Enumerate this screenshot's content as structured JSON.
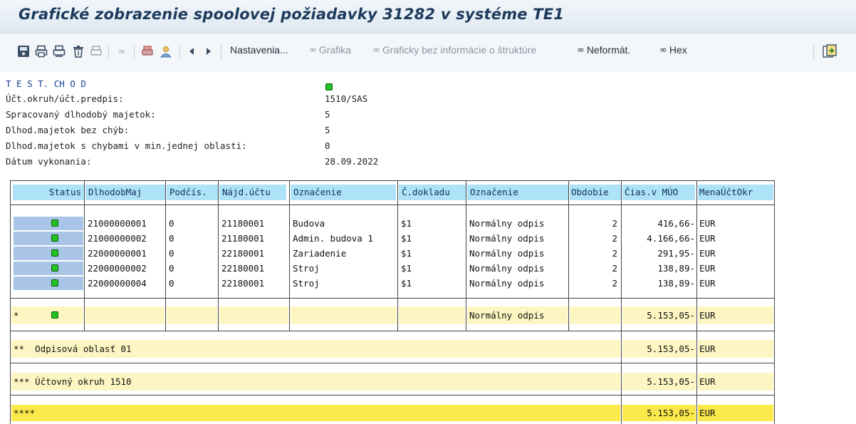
{
  "window": {
    "title": "Grafické zobrazenie spoolovej požiadavky 31282 v systéme TE1"
  },
  "toolbar": {
    "icons": [
      "save-local-icon",
      "print-icon",
      "print-immediately-icon",
      "delete-icon",
      "printer-settings-icon",
      "glasses-icon",
      "print-preview-icon",
      "user-icon",
      "previous-icon",
      "next-icon"
    ],
    "settings_label": "Nastavenia...",
    "graphic_label": "Grafika",
    "graphic_nostruct_label": "Graficky bez informácie o štruktúre",
    "unformatted_label": "Neformát.",
    "hex_label": "Hex"
  },
  "header": {
    "run_label": "T E S T. CH O D",
    "fields": [
      {
        "label": "Účt.okruh/účt.predpis:",
        "value": "1510/SAS"
      },
      {
        "label": "Spracovaný dlhodobý majetok:",
        "value": "5"
      },
      {
        "label": "Dlhod.majetok bez chýb:",
        "value": "5"
      },
      {
        "label": "Dlhod.majetok s chybami v min.jednej oblasti:",
        "value": "0"
      },
      {
        "label": "Dátum vykonania:",
        "value": "28.09.2022"
      }
    ]
  },
  "grid": {
    "columns": [
      "Status",
      "DlhodobMaj",
      "Podčís.",
      "Nájd.účtu",
      "Označenie",
      "Č.dokladu",
      "Označenie",
      "Obdobie",
      "Čias.v MÚO",
      "MenaÚčtOkr"
    ],
    "rows": [
      {
        "asset": "21000000001",
        "sub": "0",
        "account": "21180001",
        "desc": "Budova",
        "doc": "$1",
        "desc2": "Normálny odpis",
        "period": "2",
        "amount": "416,66-",
        "currency": "EUR"
      },
      {
        "asset": "21000000002",
        "sub": "0",
        "account": "21180001",
        "desc": "Admin. budova 1",
        "doc": "$1",
        "desc2": "Normálny odpis",
        "period": "2",
        "amount": "4.166,66-",
        "currency": "EUR"
      },
      {
        "asset": "22000000001",
        "sub": "0",
        "account": "22180001",
        "desc": "Zariadenie",
        "doc": "$1",
        "desc2": "Normálny odpis",
        "period": "2",
        "amount": "291,95-",
        "currency": "EUR"
      },
      {
        "asset": "22000000002",
        "sub": "0",
        "account": "22180001",
        "desc": "Stroj",
        "doc": "$1",
        "desc2": "Normálny odpis",
        "period": "2",
        "amount": "138,89-",
        "currency": "EUR"
      },
      {
        "asset": "22000000004",
        "sub": "0",
        "account": "22180001",
        "desc": "Stroj",
        "doc": "$1",
        "desc2": "Normálny odpis",
        "period": "2",
        "amount": "138,89-",
        "currency": "EUR"
      }
    ],
    "subtotal": {
      "marker": "*",
      "desc2": "Normálny odpis",
      "amount": "5.153,05-",
      "currency": "EUR"
    },
    "totals": [
      {
        "label": "**  Odpisová oblasť 01",
        "amount": "5.153,05-",
        "currency": "EUR"
      },
      {
        "label": "*** Účtovný okruh 1510",
        "amount": "5.153,05-",
        "currency": "EUR"
      },
      {
        "label": "****",
        "amount": "5.153,05-",
        "currency": "EUR"
      }
    ]
  },
  "colors": {
    "status_ok": "#22c322",
    "header_blue": "#aee3f7",
    "row_blue": "#a8c4e6",
    "light_yellow": "#fdf6c2",
    "yellow": "#fbe84a"
  }
}
